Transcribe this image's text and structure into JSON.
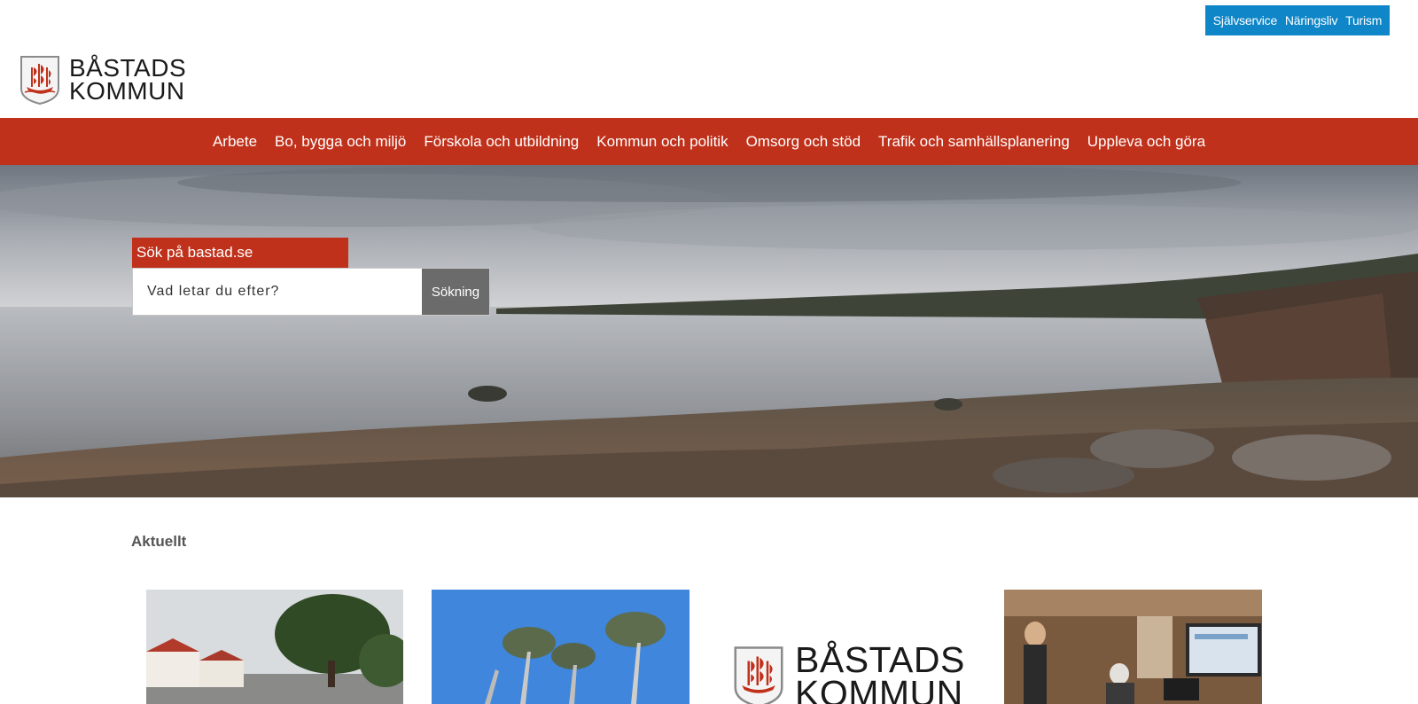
{
  "utility_links": [
    "Självservice",
    "Näringsliv",
    "Turism"
  ],
  "logo": {
    "line1": "BÅSTADS",
    "line2": "KOMMUN"
  },
  "nav": [
    "Arbete",
    "Bo, bygga och miljö",
    "Förskola och utbildning",
    "Kommun och politik",
    "Omsorg och stöd",
    "Trafik och samhällsplanering",
    "Uppleva och göra"
  ],
  "search": {
    "label": "Sök på bastad.se",
    "placeholder": "Vad letar du efter?",
    "button": "Sökning"
  },
  "news": {
    "title": "Aktuellt"
  },
  "colors": {
    "brand_red": "#c0311b",
    "utility_blue": "#0e86c8",
    "search_button": "#6b6b6b"
  }
}
